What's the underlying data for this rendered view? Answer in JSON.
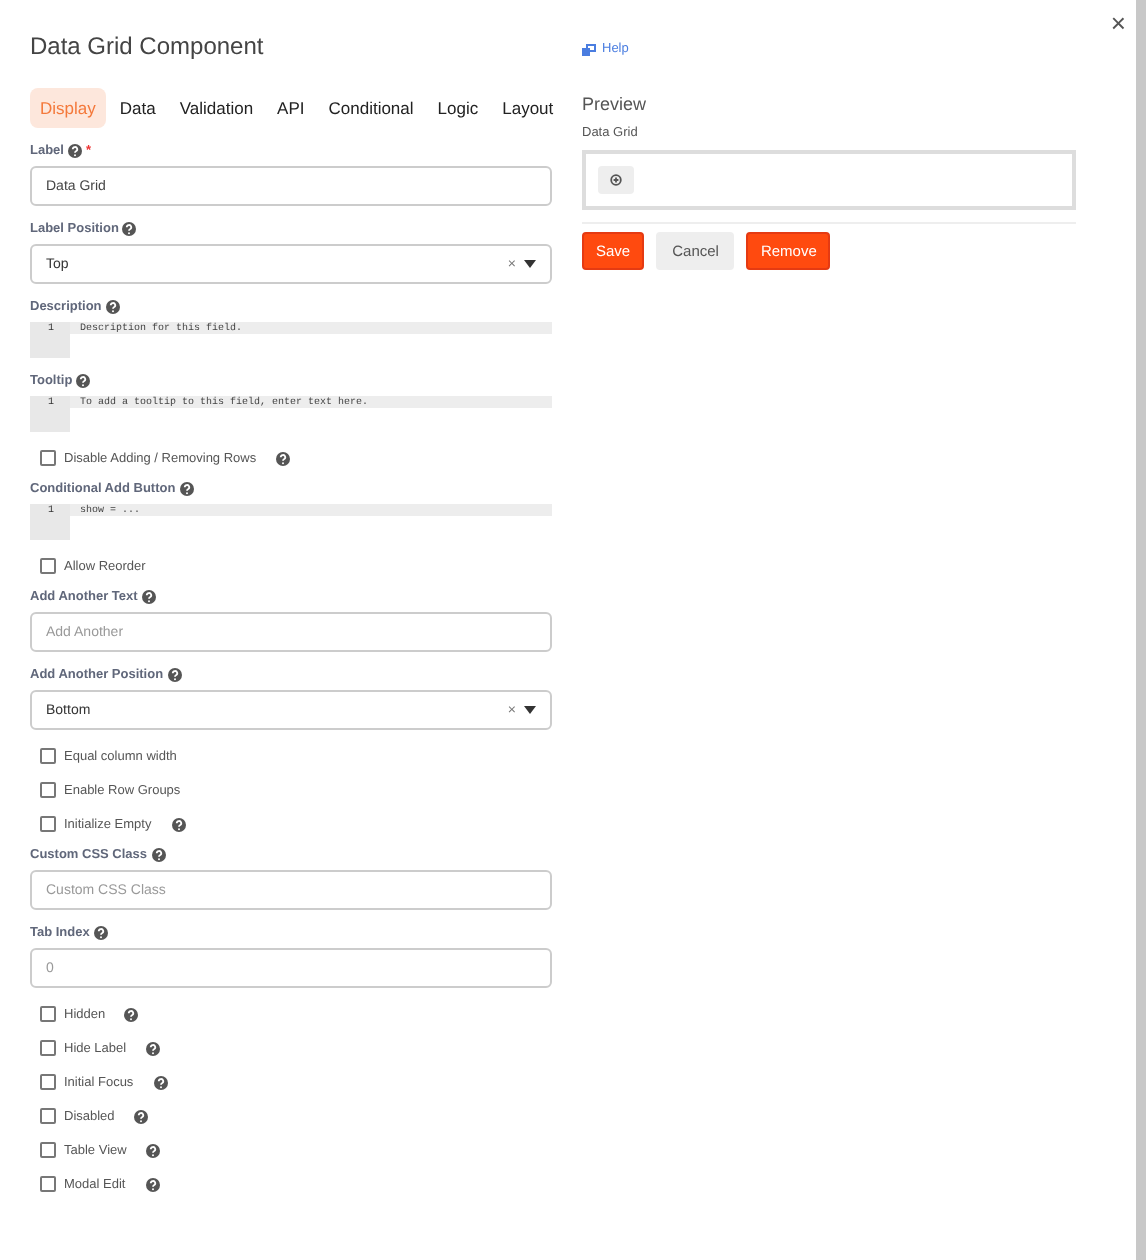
{
  "title": "Data Grid Component",
  "close": "×",
  "help_link": "Help",
  "tabs": [
    {
      "label": "Display",
      "selected": true
    },
    {
      "label": "Data",
      "selected": false
    },
    {
      "label": "Validation",
      "selected": false
    },
    {
      "label": "API",
      "selected": false
    },
    {
      "label": "Conditional",
      "selected": false
    },
    {
      "label": "Logic",
      "selected": false
    },
    {
      "label": "Layout",
      "selected": false
    }
  ],
  "fields": [
    {
      "kind": "text",
      "label": "Label",
      "help": true,
      "required_mark": "*",
      "value": "Data Grid"
    },
    {
      "kind": "select",
      "label": "Label Position",
      "help": true,
      "value": "Top",
      "clear": "×"
    },
    {
      "kind": "code",
      "label": "Description",
      "help": true,
      "line": "1",
      "code": "Description for this field."
    },
    {
      "kind": "code",
      "label": "Tooltip",
      "help": true,
      "line": "1",
      "code": "To add a tooltip to this field, enter text here."
    },
    {
      "kind": "checkbox",
      "label": "Disable Adding / Removing Rows",
      "help": true,
      "checked": false
    },
    {
      "kind": "code",
      "label": "Conditional Add Button",
      "help": true,
      "line": "1",
      "code": "show = ..."
    },
    {
      "kind": "checkbox",
      "label": "Allow Reorder",
      "help": false,
      "checked": false
    },
    {
      "kind": "text",
      "label": "Add Another Text",
      "help": true,
      "placeholder": "Add Another"
    },
    {
      "kind": "select",
      "label": "Add Another Position",
      "help": true,
      "value": "Bottom",
      "clear": "×"
    },
    {
      "kind": "checkbox",
      "label": "Equal column width",
      "help": false,
      "checked": false
    },
    {
      "kind": "checkbox",
      "label": "Enable Row Groups",
      "help": false,
      "checked": false
    },
    {
      "kind": "checkbox",
      "label": "Initialize Empty",
      "help": true,
      "checked": false
    },
    {
      "kind": "text",
      "label": "Custom CSS Class",
      "help": true,
      "placeholder": "Custom CSS Class"
    },
    {
      "kind": "text",
      "label": "Tab Index",
      "help": true,
      "placeholder": "0"
    },
    {
      "kind": "checkbox",
      "label": "Hidden",
      "help": true,
      "checked": false
    },
    {
      "kind": "checkbox",
      "label": "Hide Label",
      "help": true,
      "checked": false
    },
    {
      "kind": "checkbox",
      "label": "Initial Focus",
      "help": true,
      "checked": false
    },
    {
      "kind": "checkbox",
      "label": "Disabled",
      "help": true,
      "checked": false
    },
    {
      "kind": "checkbox",
      "label": "Table View",
      "help": true,
      "checked": false
    },
    {
      "kind": "checkbox",
      "label": "Modal Edit",
      "help": true,
      "checked": false
    }
  ],
  "preview": {
    "title": "Preview",
    "label": "Data Grid"
  },
  "buttons": [
    {
      "label": "Save",
      "kind": "primary"
    },
    {
      "label": "Cancel",
      "kind": "secondary"
    },
    {
      "label": "Remove",
      "kind": "primary"
    }
  ]
}
